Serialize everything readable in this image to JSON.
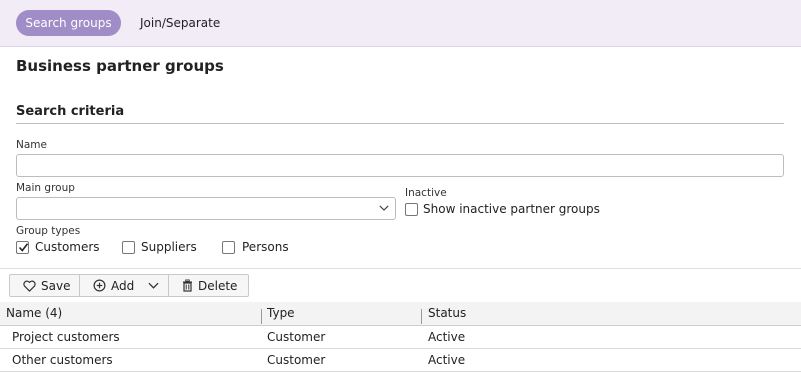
{
  "tabs": [
    {
      "label": "Search groups",
      "active": true
    },
    {
      "label": "Join/Separate",
      "active": false
    }
  ],
  "page_title": "Business partner groups",
  "search": {
    "title": "Search criteria",
    "name_label": "Name",
    "name_value": "",
    "main_group_label": "Main group",
    "main_group_value": "",
    "inactive_label": "Inactive",
    "show_inactive_label": "Show inactive partner groups",
    "show_inactive_checked": false,
    "group_types_label": "Group types",
    "group_types": [
      {
        "label": "Customers",
        "checked": true
      },
      {
        "label": "Suppliers",
        "checked": false
      },
      {
        "label": "Persons",
        "checked": false
      }
    ]
  },
  "toolbar": {
    "save_label": "Save",
    "add_label": "Add",
    "delete_label": "Delete"
  },
  "table": {
    "headers": [
      "Name (4)",
      "Type",
      "Status"
    ],
    "rows": [
      {
        "name": "Project customers",
        "type": "Customer",
        "status": "Active"
      },
      {
        "name": "Other customers",
        "type": "Customer",
        "status": "Active"
      }
    ]
  },
  "colors": {
    "accent": "#a08cc6",
    "topbar_bg": "#f1ecf6"
  }
}
